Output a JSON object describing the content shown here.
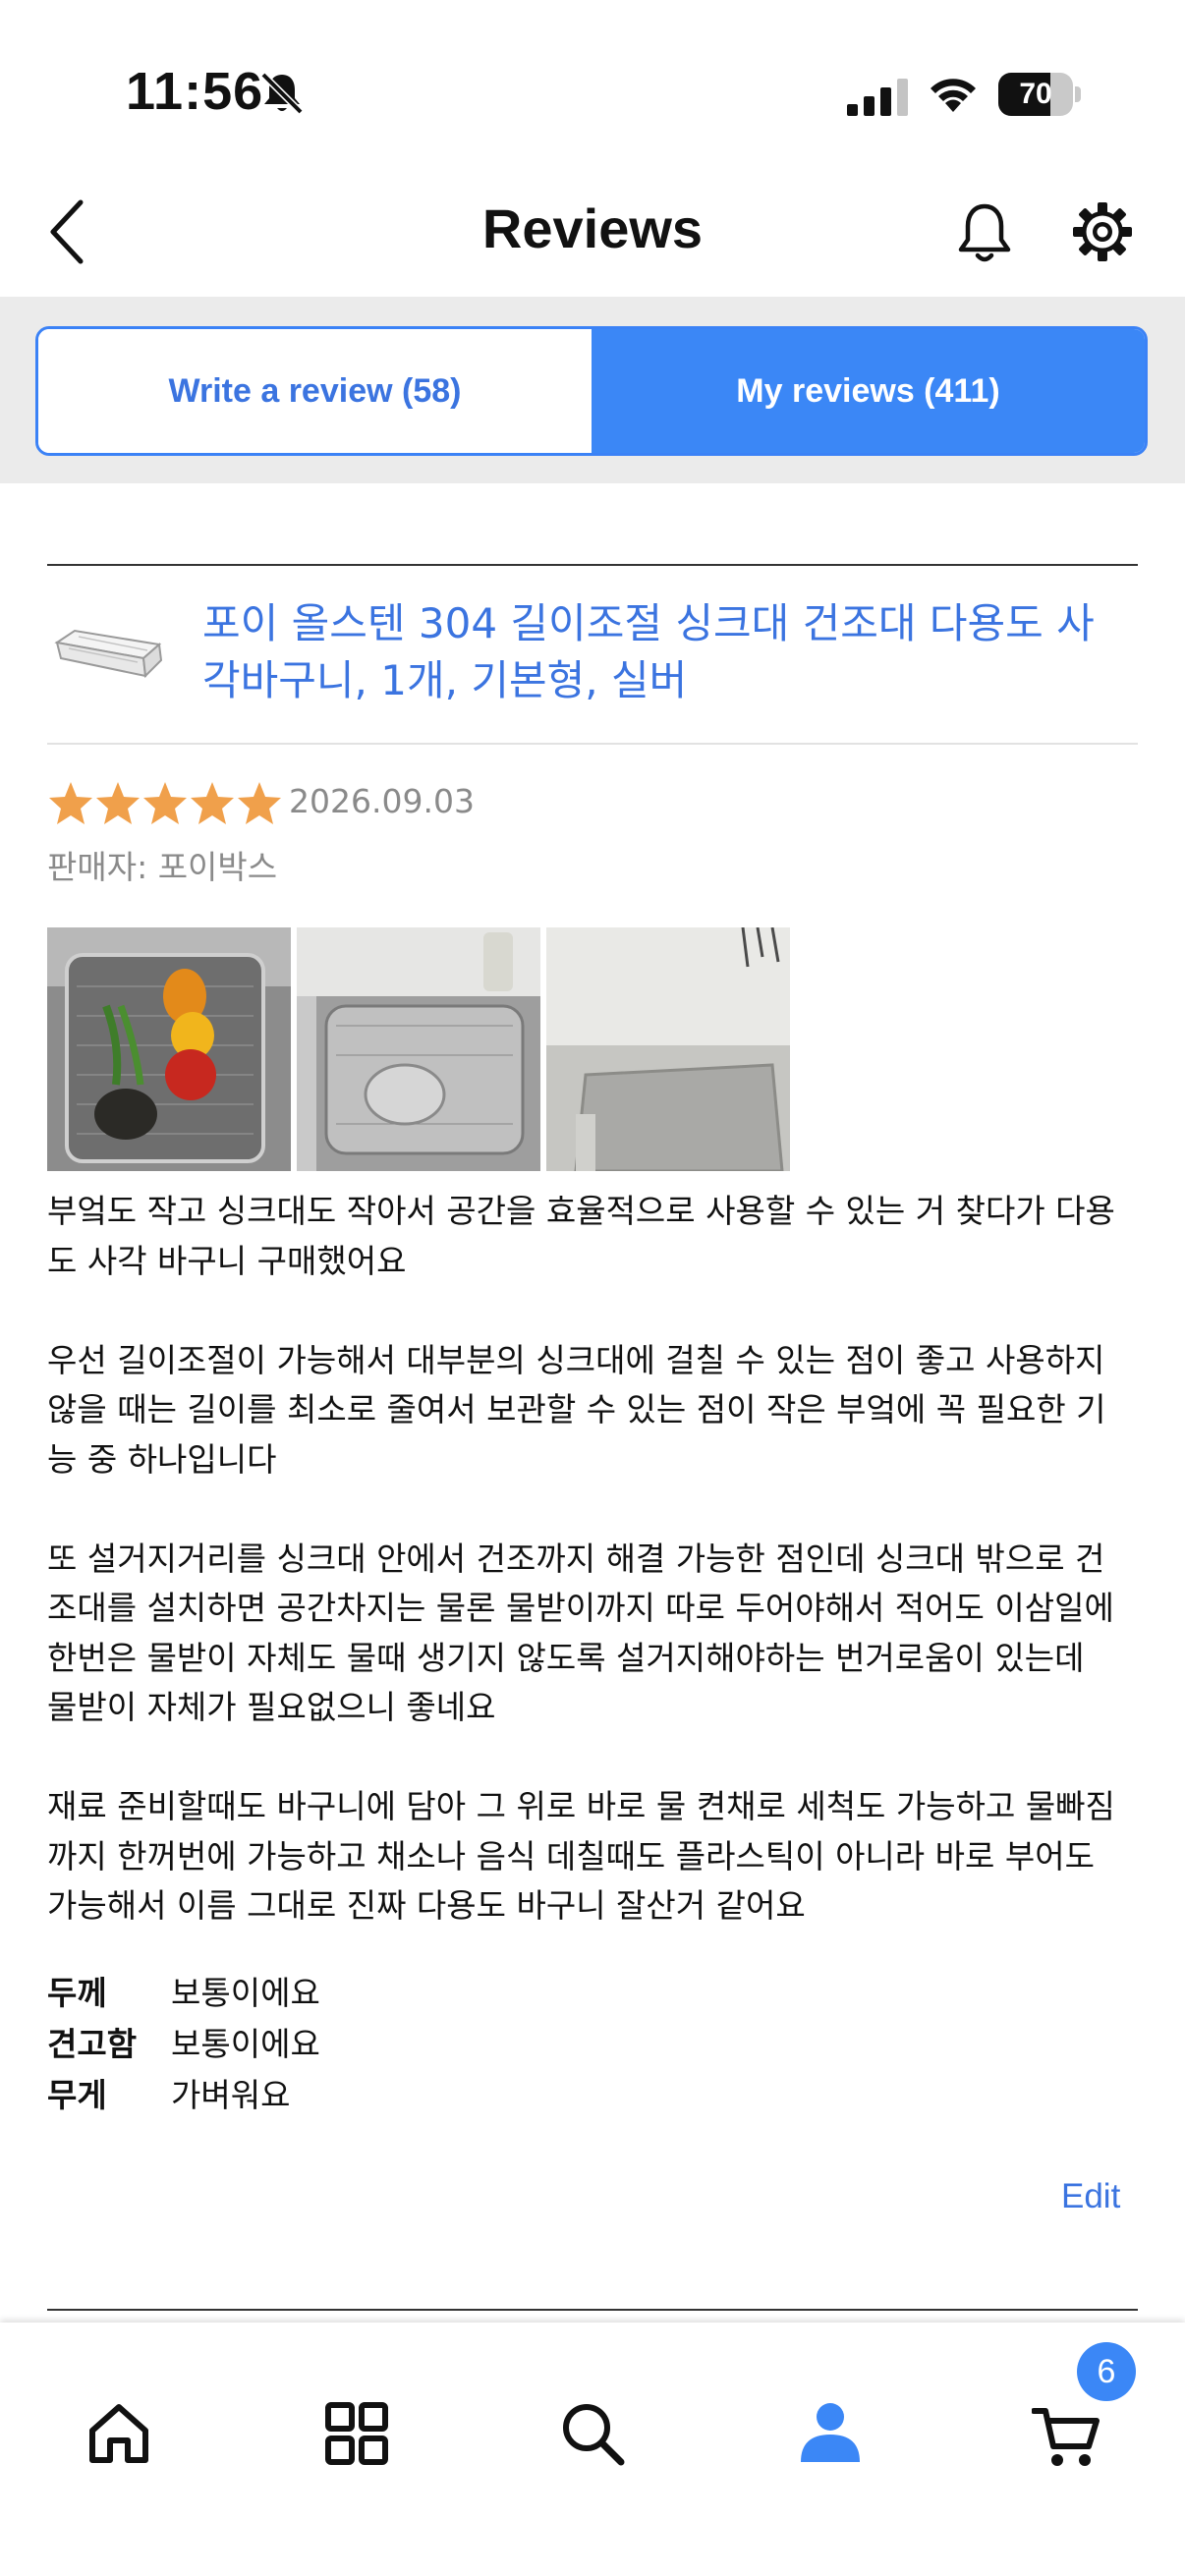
{
  "status_bar": {
    "time": "11:56",
    "battery": "70",
    "battery_level": 0.7
  },
  "header": {
    "title": "Reviews"
  },
  "tabs": [
    {
      "label": "Write a review (58)",
      "active": false
    },
    {
      "label": "My reviews (411)",
      "active": true
    }
  ],
  "review": {
    "product_name": "포이 올스텐 304 길이조절 싱크대 건조대 다용도 사각바구니, 1개, 기본형, 실버",
    "rating": 5,
    "rating_max": 5,
    "date": "2026.09.03",
    "seller": "판매자: 포이박스",
    "body": "부엌도 작고 싱크대도 작아서 공간을 효율적으로 사용할 수 있는 거 찾다가 다용\n도 사각 바구니 구매했어요\n\n우선 길이조절이 가능해서 대부분의 싱크대에 걸칠 수 있는 점이 좋고 사용하지\n않을 때는 길이를 최소로 줄여서 보관할 수 있는 점이 작은 부엌에 꼭 필요한 기\n능 중 하나입니다\n\n또 설거지거리를 싱크대 안에서 건조까지 해결 가능한 점인데 싱크대 밖으로 건\n조대를 설치하면 공간차지는 물론 물받이까지 따로 두어야해서 적어도 이삼일에\n한번은 물받이 자체도 물때 생기지 않도록 설거지해야하는 번거로움이 있는데\n물받이 자체가 필요없으니 좋네요\n\n재료 준비할때도 바구니에 담아 그 위로 바로 물 켠채로 세척도 가능하고 물빠짐\n까지 한꺼번에 가능하고 채소나 음식 데칠때도 플라스틱이 아니라 바로 부어도\n가능해서 이름 그대로 진짜 다용도 바구니 잘산거 같어요",
    "attributes": [
      {
        "label": "두께",
        "value": "보통이에요"
      },
      {
        "label": "견고함",
        "value": "보통이에요"
      },
      {
        "label": "무게",
        "value": "가벼워요"
      }
    ],
    "edit_label": "Edit"
  },
  "bottom_nav": {
    "items": [
      "home-icon",
      "categories-icon",
      "search-icon",
      "account-icon",
      "cart-icon"
    ],
    "active": "account-icon",
    "cart_count": "6"
  },
  "colors": {
    "accent": "#3b87f6",
    "link": "#3b74e0",
    "star": "#f0a04b"
  }
}
